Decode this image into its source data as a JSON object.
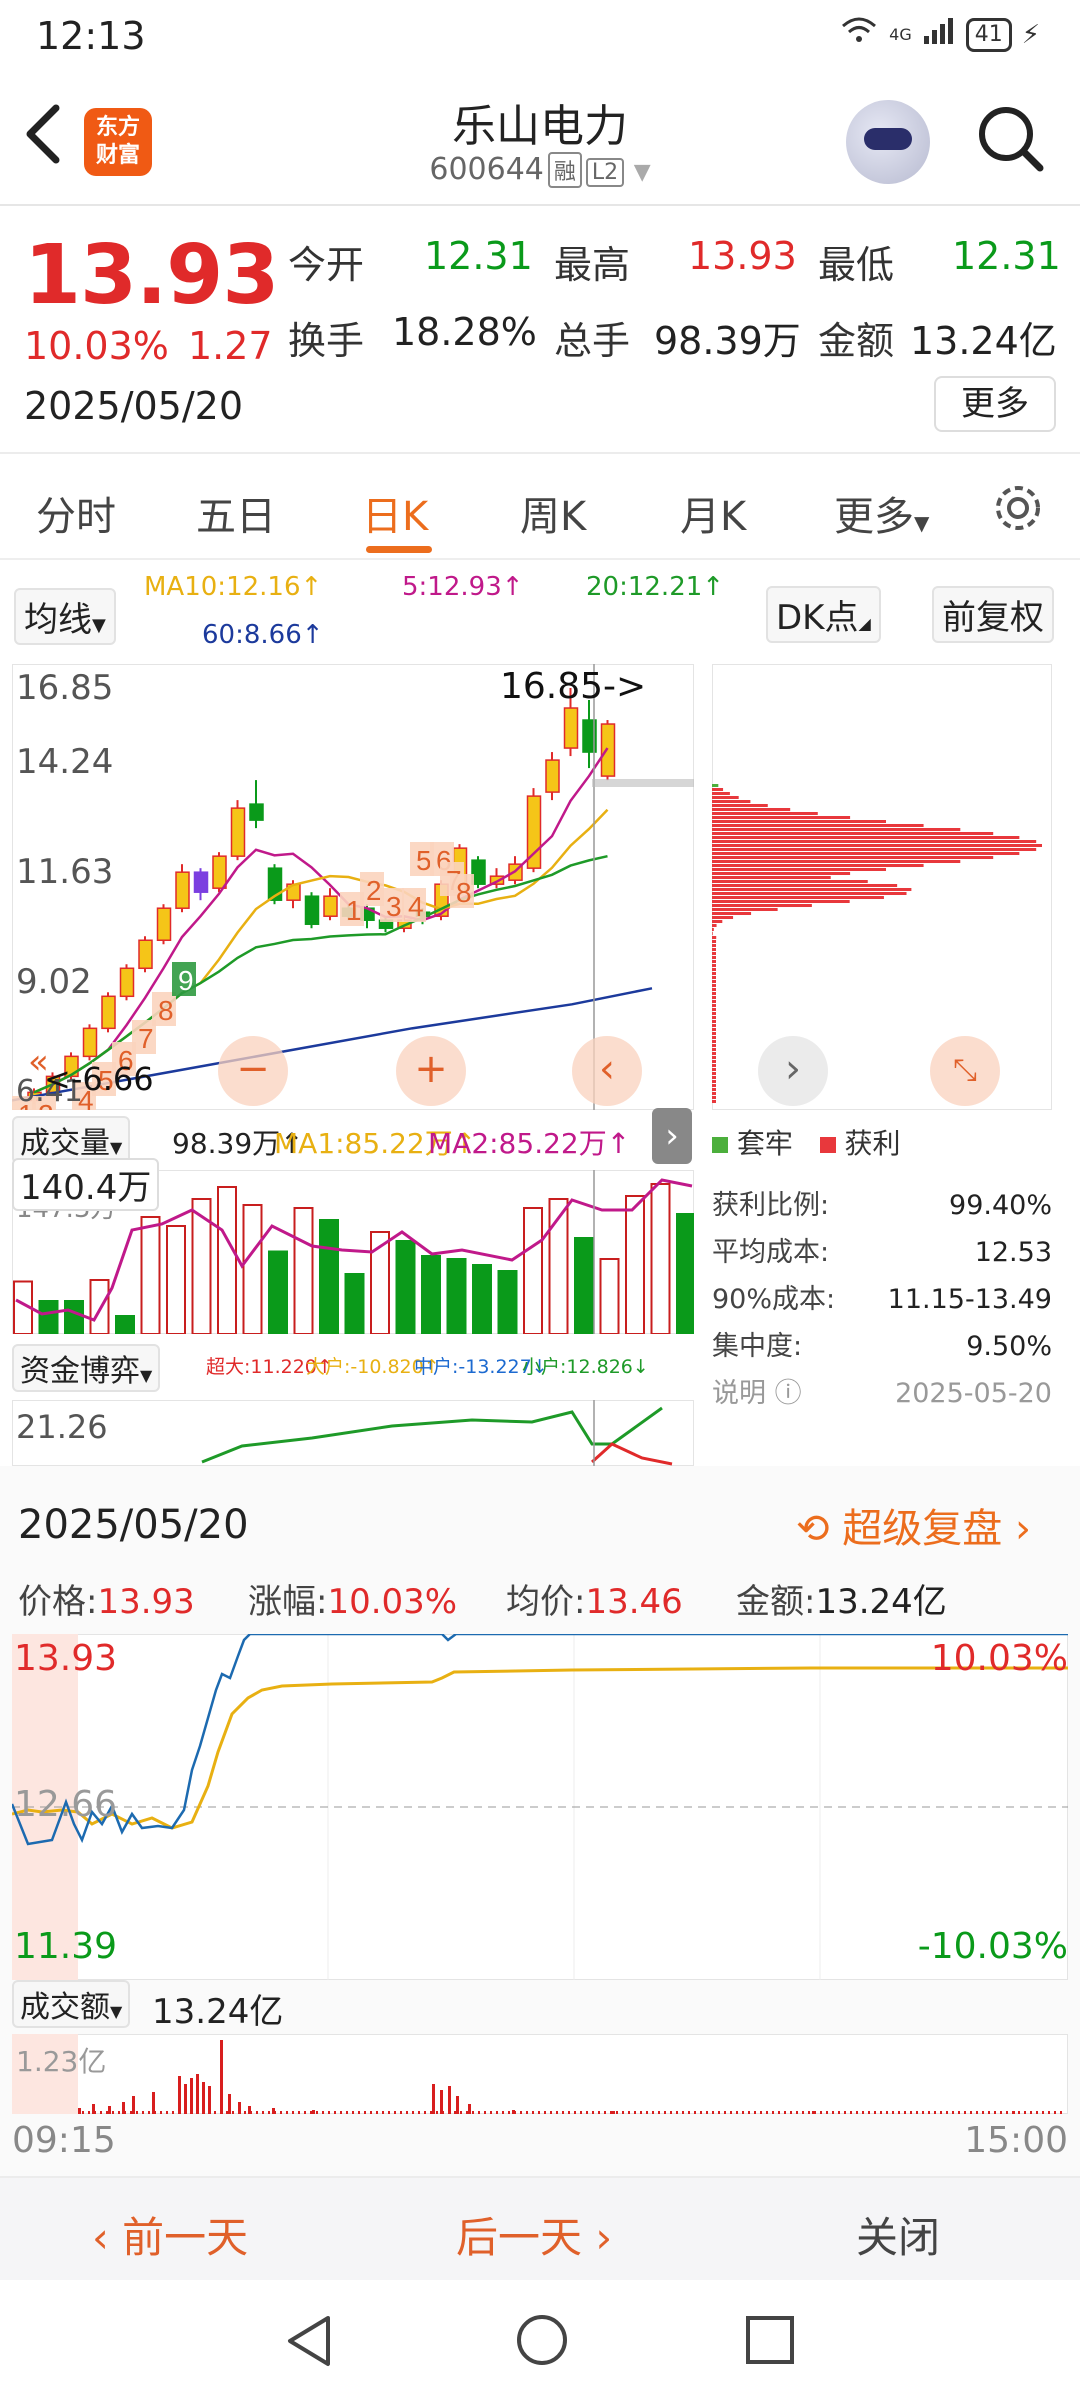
{
  "status": {
    "time": "12:13",
    "signal": "4G",
    "battery": "41"
  },
  "header": {
    "logo_line1": "东方",
    "logo_line2": "财富",
    "name": "乐山电力",
    "code": "600644",
    "tag1": "融",
    "tag2": "L2"
  },
  "quote": {
    "price": "13.93",
    "change_pct": "10.03%",
    "change": "1.27",
    "date": "2025/05/20",
    "open_label": "今开",
    "open": "12.31",
    "high_label": "最高",
    "high": "13.93",
    "low_label": "最低",
    "low": "12.31",
    "turnover_label": "换手",
    "turnover": "18.28%",
    "volume_label": "总手",
    "volume": "98.39万",
    "amount_label": "金额",
    "amount": "13.24亿",
    "more": "更多"
  },
  "tabs": [
    "分时",
    "五日",
    "日K",
    "周K",
    "月K",
    "更多"
  ],
  "kline": {
    "ma_select": "均线",
    "ma10": "MA10:12.16↑",
    "ma5": "5:12.93↑",
    "ma20": "20:12.21↑",
    "ma60": "60:8.66↑",
    "dk": "DK点",
    "fq": "前复权",
    "y_ticks": [
      "16.85",
      "14.24",
      "11.63",
      "9.02",
      "6.41"
    ],
    "max_label": "16.85->",
    "min_label": "<-6.66",
    "td_labels": [
      "1",
      "2",
      "3",
      "4",
      "5",
      "6",
      "7",
      "8",
      "9",
      "1",
      "2",
      "3",
      "4",
      "5",
      "6",
      "7",
      "8"
    ],
    "colors": {
      "up": "#e02a2a",
      "down": "#0a9a1a",
      "ma5": "#c0198a",
      "ma10": "#e8b012",
      "ma20": "#1e9a28",
      "ma60": "#1c3a9c"
    }
  },
  "volume": {
    "select": "成交量",
    "value": "98.39万↑",
    "ma1": "MA1:85.22万↑",
    "ma2": "MA2:85.22万↑",
    "tooltip": "140.4万",
    "tick": "147.3万"
  },
  "fund": {
    "select": "资金博弈",
    "super": "超大:11.220↑",
    "big": "大户:-10.820↑",
    "mid": "中户:-13.227↓",
    "small": "小户:12.826↓",
    "tick": "21.26"
  },
  "chip": {
    "legend_trap": "套牢",
    "legend_profit": "获利",
    "profit_ratio_label": "获利比例:",
    "profit_ratio": "99.40%",
    "avg_cost_label": "平均成本:",
    "avg_cost": "12.53",
    "cost90_label": "90%成本:",
    "cost90": "11.15-13.49",
    "concentration_label": "集中度:",
    "concentration": "9.50%",
    "desc": "说明",
    "date": "2025-05-20"
  },
  "intraday": {
    "date": "2025/05/20",
    "replay": "超级复盘",
    "price_label": "价格:",
    "price": "13.93",
    "pct_label": "涨幅:",
    "pct": "10.03%",
    "avg_label": "均价:",
    "avg": "13.46",
    "amt_label": "金额:",
    "amt": "13.24亿",
    "y_top": "13.93",
    "y_mid": "12.66",
    "y_bot": "11.39",
    "pct_top": "10.03%",
    "pct_bot": "-10.03%",
    "amt_select": "成交额",
    "amt_value": "13.24亿",
    "amt_tick": "1.23亿",
    "t_start": "09:15",
    "t_end": "15:00"
  },
  "bottom_nav": {
    "prev": "前一天",
    "next": "后一天",
    "close": "关闭"
  }
}
